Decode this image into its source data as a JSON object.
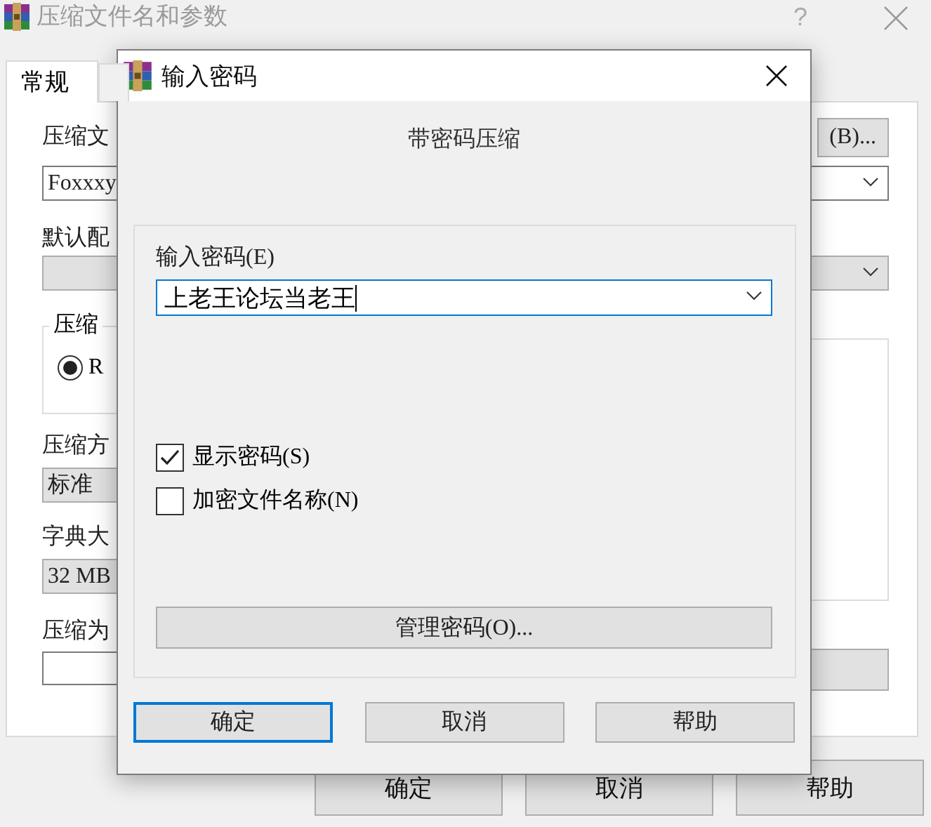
{
  "window": {
    "title": "压缩文件名和参数",
    "help": "?"
  },
  "tabs": [
    {
      "label": "常规",
      "selected": true
    },
    {
      "selected": false
    }
  ],
  "general": {
    "archive_name_label": "压缩文",
    "browse_button": "(B)...",
    "archive_name": "Foxxxy",
    "profile_label": "默认配",
    "format_group": "压缩",
    "format_option": {
      "label": "R",
      "selected": true
    },
    "method_label": "压缩方",
    "method": "标准",
    "dictionary_label": "字典大",
    "dictionary": "32 MB",
    "split_label": "压缩为"
  },
  "buttons": [
    "确定",
    "取消",
    "帮助"
  ],
  "dialog": {
    "title": "输入密码",
    "heading": "带密码压缩",
    "password_label": "输入密码(E)",
    "password": "上老王论坛当老王",
    "options": [
      {
        "label": "显示密码(S)",
        "checked": true
      },
      {
        "label": "加密文件名称(N)",
        "checked": false
      }
    ],
    "manage_button": "管理密码(O)...",
    "buttons": [
      {
        "label": "确定",
        "focused": true
      },
      {
        "label": "取消",
        "focused": false
      },
      {
        "label": "帮助",
        "focused": false
      }
    ]
  }
}
